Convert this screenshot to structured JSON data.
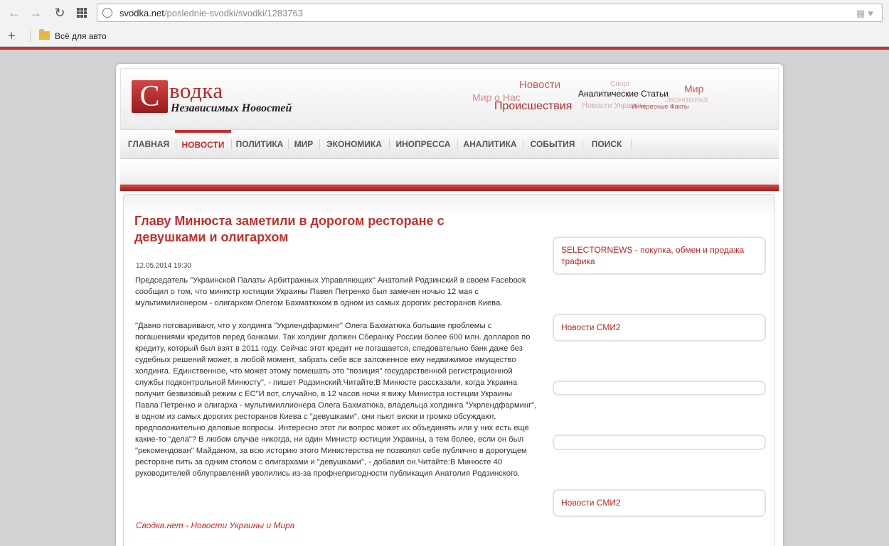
{
  "browser": {
    "url_host": "svodka.net",
    "url_path": "/poslednie-svodki/svodki/1283763",
    "bookmark_label": "Всё для авто",
    "icons": [
      "back-icon",
      "forward-icon",
      "reload-icon",
      "apps-icon",
      "page-globe-icon",
      "extensions-icon",
      "heart-icon",
      "add-bookmark-icon",
      "folder-icon"
    ]
  },
  "site": {
    "logo_letter": "С",
    "logo_title": "водка",
    "logo_subtitle": "Независимых Новостей",
    "cloud": [
      "Новости",
      "Спорт",
      "Мир о Нас",
      "Аналитические Статьи",
      "Мир",
      "Экономика",
      "Происшествия",
      "Новости Украины",
      "Интересные Факты"
    ],
    "menu": [
      "ГЛАВНАЯ",
      "НОВОСТИ",
      "ПОЛИТИКА",
      "МИР",
      "ЭКОНОМИКА",
      "ИНОПРЕССА",
      "АНАЛИТИКА",
      "СОБЫТИЯ",
      "ПОИСК"
    ],
    "menu_active": "НОВОСТИ",
    "accent_color": "#c0302c"
  },
  "article": {
    "title": "Главу Минюста заметили в дорогом ресторане с девушками и олигархом",
    "date": "12.05.2014 19:30",
    "paragraphs": [
      "Председатель \"Украинской Палаты Арбитражных Управляющих\" Анатолий Родзинский в своем Facebook сообщил о том, что министр юстиции Украины Павел Петренко был замечен ночью 12 мая с мультимилионером - олигархом Олегом Бахматюком в одном из самых дорогих ресторанов Киева.",
      "\"Давно поговаривают, что у холдинга \"Укрлендфарминг\" Олега Бахматюка большие проблемы с погашениями кредитов перед банками. Так холдинг должен Сберанку России более 600 млн. долларов по кредиту, который был взят в 2011 году. Сейчас этот кредит не погашается, следовательно банк даже без судебных решений может, в любой момент, забрать себе все заложенное ему недвижимое имущество холдинга. Единственное, что может этому помешать это \"позиция\" государственной регистрационной службы подконтрольной Минюсту\", - пишет Родзинский.Читайте:В Минюсте рассказали, когда Украина получит безвизовый режим с ЕС\"И вот, случайно, в 12 часов ночи я вижу Министра юстиции Украины Павла Петренко и олигарха - мультимиллионера Олега Бахматюка, владельца холдинга \"Укрлендфарминг\", в одном из самых дорогих ресторанов Киева с \"девушками\", они пьют виски и громко обсуждают, предположительно деловые вопросы. Интересно этот ли вопрос может их объединять или у них есть еще какие-то \"дела\"? В любом случае никогда, ни один Министр юстиции Украины, а тем более, если он был \"рекомендован\" Майданом, за всю историю этого Министерства не позволял себе публично в дорогущем ресторане пить за одним столом с олигархами и \"девушками\", - добавил он.Читайте:В Минюсте 40 руководителей облуправлений уволились из-за профнепригодности\n   публикация Анатолия Родзинского."
    ],
    "source": "Сводка.нет - Новости Украины и Мира"
  },
  "sidebar": {
    "widgets": [
      {
        "title": "SELECTORNEWS - покупка, обмен и продажа трафика"
      },
      {
        "title": "Новости СМИ2"
      },
      {
        "title": ""
      },
      {
        "title": ""
      },
      {
        "title": "Новости СМИ2"
      }
    ]
  }
}
